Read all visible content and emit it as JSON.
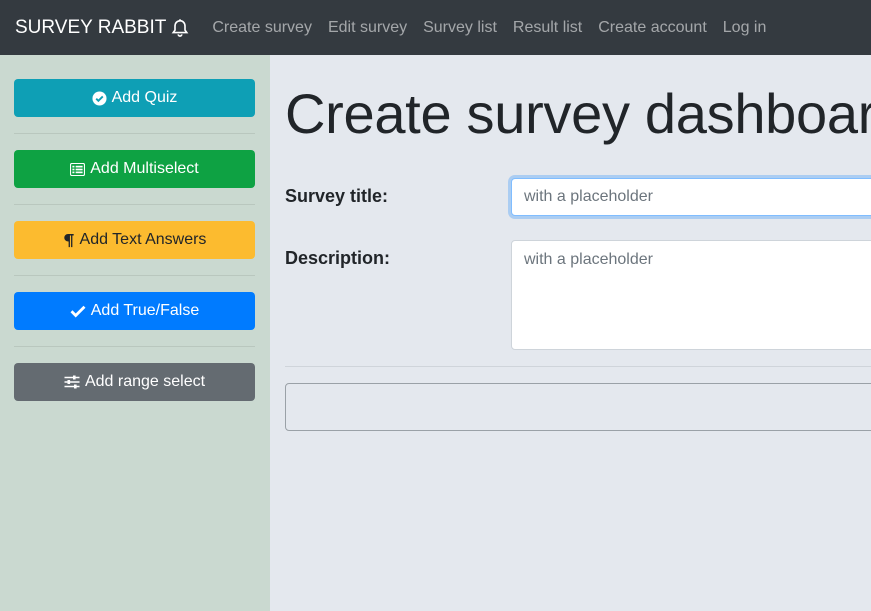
{
  "navbar": {
    "brand": "SURVEY RABBIT",
    "links": [
      "Create survey",
      "Edit survey",
      "Survey list",
      "Result list",
      "Create account",
      "Log in"
    ]
  },
  "sidebar": {
    "buttons": [
      {
        "label": "Add Quiz",
        "icon": "check-circle-icon",
        "color": "#0e9fb5"
      },
      {
        "label": "Add Multiselect",
        "icon": "list-icon",
        "color": "#0ea243"
      },
      {
        "label": "Add Text Answers",
        "icon": "paragraph-icon",
        "color": "#fcbb2f"
      },
      {
        "label": "Add True/False",
        "icon": "check-icon",
        "color": "#007bff"
      },
      {
        "label": "Add range select",
        "icon": "sliders-icon",
        "color": "#646b71"
      }
    ]
  },
  "main": {
    "title": "Create survey dashboard",
    "survey_title_label": "Survey title:",
    "survey_title_placeholder": "with a placeholder",
    "description_label": "Description:",
    "description_placeholder": "with a placeholder"
  }
}
